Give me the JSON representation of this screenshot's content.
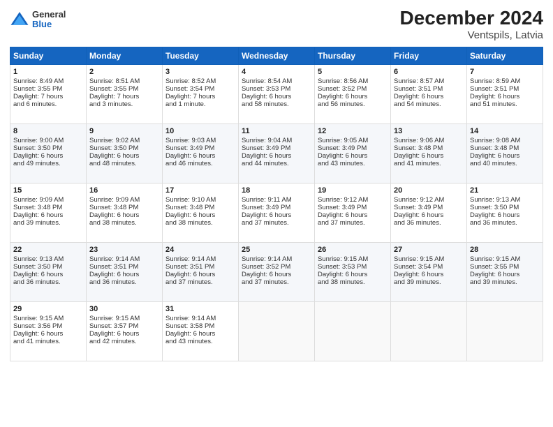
{
  "header": {
    "logo": {
      "general": "General",
      "blue": "Blue"
    },
    "title": "December 2024",
    "subtitle": "Ventspils, Latvia"
  },
  "weekdays": [
    "Sunday",
    "Monday",
    "Tuesday",
    "Wednesday",
    "Thursday",
    "Friday",
    "Saturday"
  ],
  "weeks": [
    [
      {
        "day": "1",
        "lines": [
          "Sunrise: 8:49 AM",
          "Sunset: 3:55 PM",
          "Daylight: 7 hours",
          "and 6 minutes."
        ]
      },
      {
        "day": "2",
        "lines": [
          "Sunrise: 8:51 AM",
          "Sunset: 3:55 PM",
          "Daylight: 7 hours",
          "and 3 minutes."
        ]
      },
      {
        "day": "3",
        "lines": [
          "Sunrise: 8:52 AM",
          "Sunset: 3:54 PM",
          "Daylight: 7 hours",
          "and 1 minute."
        ]
      },
      {
        "day": "4",
        "lines": [
          "Sunrise: 8:54 AM",
          "Sunset: 3:53 PM",
          "Daylight: 6 hours",
          "and 58 minutes."
        ]
      },
      {
        "day": "5",
        "lines": [
          "Sunrise: 8:56 AM",
          "Sunset: 3:52 PM",
          "Daylight: 6 hours",
          "and 56 minutes."
        ]
      },
      {
        "day": "6",
        "lines": [
          "Sunrise: 8:57 AM",
          "Sunset: 3:51 PM",
          "Daylight: 6 hours",
          "and 54 minutes."
        ]
      },
      {
        "day": "7",
        "lines": [
          "Sunrise: 8:59 AM",
          "Sunset: 3:51 PM",
          "Daylight: 6 hours",
          "and 51 minutes."
        ]
      }
    ],
    [
      {
        "day": "8",
        "lines": [
          "Sunrise: 9:00 AM",
          "Sunset: 3:50 PM",
          "Daylight: 6 hours",
          "and 49 minutes."
        ]
      },
      {
        "day": "9",
        "lines": [
          "Sunrise: 9:02 AM",
          "Sunset: 3:50 PM",
          "Daylight: 6 hours",
          "and 48 minutes."
        ]
      },
      {
        "day": "10",
        "lines": [
          "Sunrise: 9:03 AM",
          "Sunset: 3:49 PM",
          "Daylight: 6 hours",
          "and 46 minutes."
        ]
      },
      {
        "day": "11",
        "lines": [
          "Sunrise: 9:04 AM",
          "Sunset: 3:49 PM",
          "Daylight: 6 hours",
          "and 44 minutes."
        ]
      },
      {
        "day": "12",
        "lines": [
          "Sunrise: 9:05 AM",
          "Sunset: 3:49 PM",
          "Daylight: 6 hours",
          "and 43 minutes."
        ]
      },
      {
        "day": "13",
        "lines": [
          "Sunrise: 9:06 AM",
          "Sunset: 3:48 PM",
          "Daylight: 6 hours",
          "and 41 minutes."
        ]
      },
      {
        "day": "14",
        "lines": [
          "Sunrise: 9:08 AM",
          "Sunset: 3:48 PM",
          "Daylight: 6 hours",
          "and 40 minutes."
        ]
      }
    ],
    [
      {
        "day": "15",
        "lines": [
          "Sunrise: 9:09 AM",
          "Sunset: 3:48 PM",
          "Daylight: 6 hours",
          "and 39 minutes."
        ]
      },
      {
        "day": "16",
        "lines": [
          "Sunrise: 9:09 AM",
          "Sunset: 3:48 PM",
          "Daylight: 6 hours",
          "and 38 minutes."
        ]
      },
      {
        "day": "17",
        "lines": [
          "Sunrise: 9:10 AM",
          "Sunset: 3:48 PM",
          "Daylight: 6 hours",
          "and 38 minutes."
        ]
      },
      {
        "day": "18",
        "lines": [
          "Sunrise: 9:11 AM",
          "Sunset: 3:49 PM",
          "Daylight: 6 hours",
          "and 37 minutes."
        ]
      },
      {
        "day": "19",
        "lines": [
          "Sunrise: 9:12 AM",
          "Sunset: 3:49 PM",
          "Daylight: 6 hours",
          "and 37 minutes."
        ]
      },
      {
        "day": "20",
        "lines": [
          "Sunrise: 9:12 AM",
          "Sunset: 3:49 PM",
          "Daylight: 6 hours",
          "and 36 minutes."
        ]
      },
      {
        "day": "21",
        "lines": [
          "Sunrise: 9:13 AM",
          "Sunset: 3:50 PM",
          "Daylight: 6 hours",
          "and 36 minutes."
        ]
      }
    ],
    [
      {
        "day": "22",
        "lines": [
          "Sunrise: 9:13 AM",
          "Sunset: 3:50 PM",
          "Daylight: 6 hours",
          "and 36 minutes."
        ]
      },
      {
        "day": "23",
        "lines": [
          "Sunrise: 9:14 AM",
          "Sunset: 3:51 PM",
          "Daylight: 6 hours",
          "and 36 minutes."
        ]
      },
      {
        "day": "24",
        "lines": [
          "Sunrise: 9:14 AM",
          "Sunset: 3:51 PM",
          "Daylight: 6 hours",
          "and 37 minutes."
        ]
      },
      {
        "day": "25",
        "lines": [
          "Sunrise: 9:14 AM",
          "Sunset: 3:52 PM",
          "Daylight: 6 hours",
          "and 37 minutes."
        ]
      },
      {
        "day": "26",
        "lines": [
          "Sunrise: 9:15 AM",
          "Sunset: 3:53 PM",
          "Daylight: 6 hours",
          "and 38 minutes."
        ]
      },
      {
        "day": "27",
        "lines": [
          "Sunrise: 9:15 AM",
          "Sunset: 3:54 PM",
          "Daylight: 6 hours",
          "and 39 minutes."
        ]
      },
      {
        "day": "28",
        "lines": [
          "Sunrise: 9:15 AM",
          "Sunset: 3:55 PM",
          "Daylight: 6 hours",
          "and 39 minutes."
        ]
      }
    ],
    [
      {
        "day": "29",
        "lines": [
          "Sunrise: 9:15 AM",
          "Sunset: 3:56 PM",
          "Daylight: 6 hours",
          "and 41 minutes."
        ]
      },
      {
        "day": "30",
        "lines": [
          "Sunrise: 9:15 AM",
          "Sunset: 3:57 PM",
          "Daylight: 6 hours",
          "and 42 minutes."
        ]
      },
      {
        "day": "31",
        "lines": [
          "Sunrise: 9:14 AM",
          "Sunset: 3:58 PM",
          "Daylight: 6 hours",
          "and 43 minutes."
        ]
      },
      null,
      null,
      null,
      null
    ]
  ]
}
